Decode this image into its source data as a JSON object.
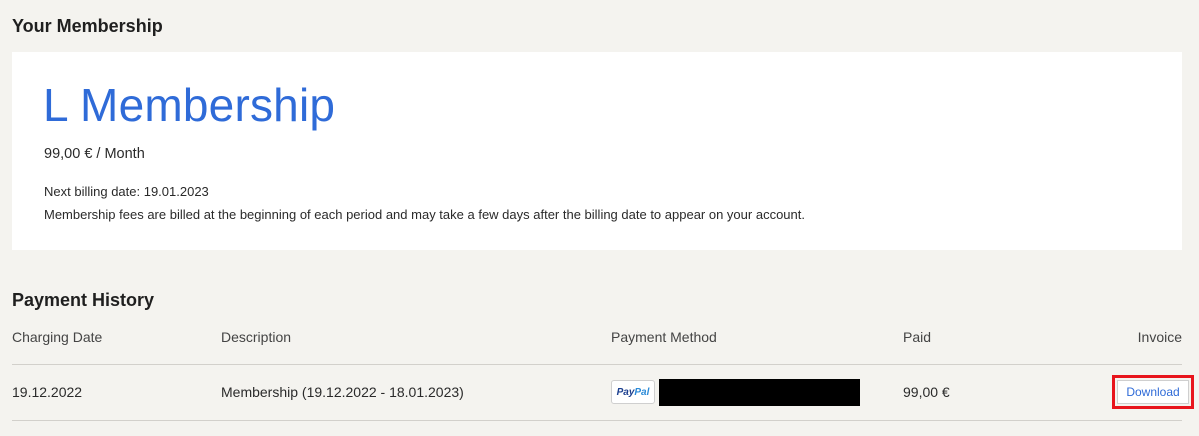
{
  "membership": {
    "heading": "Your Membership",
    "plan_name": "L Membership",
    "price": "99,00 € / Month",
    "next_billing": "Next billing date: 19.01.2023",
    "note": "Membership fees are billed at the beginning of each period and may take a few days after the billing date to appear on your account.",
    "accent_color": "#2f6bd8"
  },
  "payment_history": {
    "heading": "Payment History",
    "columns": [
      "Charging Date",
      "Description",
      "Payment Method",
      "Paid",
      "Invoice"
    ],
    "rows": [
      {
        "charging_date": "19.12.2022",
        "description": "Membership (19.12.2022 - 18.01.2023)",
        "payment_method": {
          "brand_part1": "Pay",
          "brand_part2": "Pal",
          "icon": "paypal-logo-icon",
          "details_redacted": true
        },
        "paid": "99,00 €",
        "invoice_action": "Download"
      }
    ]
  },
  "highlight_color": "#e8141c"
}
